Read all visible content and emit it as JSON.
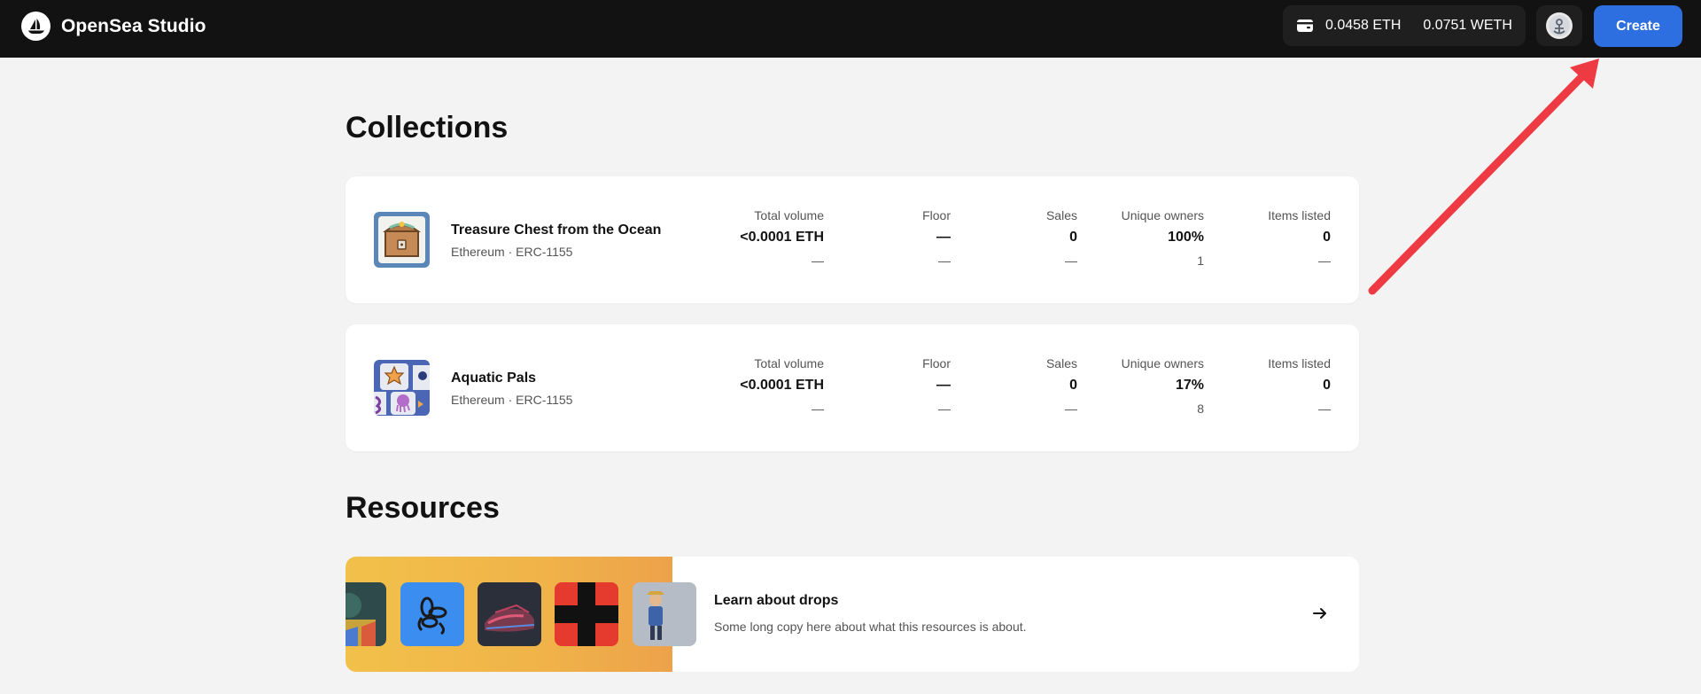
{
  "header": {
    "brand_name": "OpenSea Studio",
    "wallet_eth": "0.0458 ETH",
    "wallet_weth": "0.0751 WETH",
    "create_label": "Create"
  },
  "collections": {
    "heading": "Collections",
    "items": [
      {
        "name": "Treasure Chest from the Ocean",
        "subtitle": "Ethereum · ERC-1155",
        "stats": [
          {
            "label": "Total volume",
            "value": "<0.0001 ETH",
            "sub": "—"
          },
          {
            "label": "Floor",
            "value": "—",
            "sub": "—"
          },
          {
            "label": "Sales",
            "value": "0",
            "sub": "—"
          },
          {
            "label": "Unique owners",
            "value": "100%",
            "sub": "1"
          },
          {
            "label": "Items listed",
            "value": "0",
            "sub": "—"
          }
        ]
      },
      {
        "name": "Aquatic Pals",
        "subtitle": "Ethereum · ERC-1155",
        "stats": [
          {
            "label": "Total volume",
            "value": "<0.0001 ETH",
            "sub": "—"
          },
          {
            "label": "Floor",
            "value": "—",
            "sub": "—"
          },
          {
            "label": "Sales",
            "value": "0",
            "sub": "—"
          },
          {
            "label": "Unique owners",
            "value": "17%",
            "sub": "8"
          },
          {
            "label": "Items listed",
            "value": "0",
            "sub": "—"
          }
        ]
      }
    ]
  },
  "resources": {
    "heading": "Resources",
    "items": [
      {
        "title": "Learn about drops",
        "description": "Some long copy here about what this resources is about."
      }
    ]
  },
  "colors": {
    "header_bg": "#121212",
    "accent": "#2d6fe0",
    "annotation_arrow": "#ee3a43"
  },
  "icons": [
    "opensea-logo-icon",
    "wallet-icon",
    "avatar-icon",
    "arrow-right-icon"
  ]
}
